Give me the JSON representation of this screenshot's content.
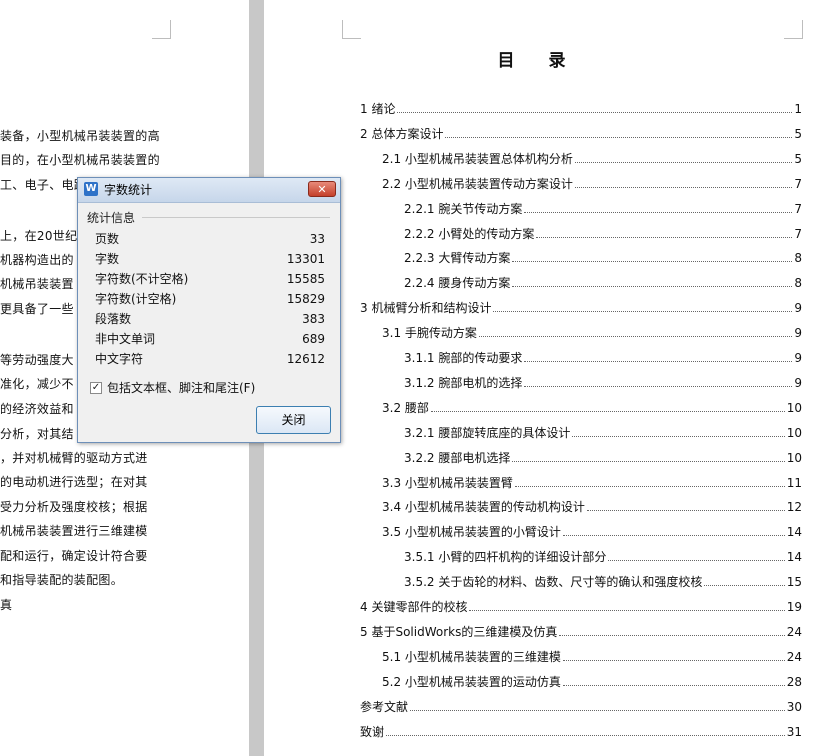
{
  "left_page": {
    "lines": [
      {
        "text": "装备，小型机械吊装装置的高"
      },
      {
        "text": "目的，在小型机械吊装装置的"
      },
      {
        "text": "工、电子、电路"
      },
      {
        "text": "上，在20世纪"
      },
      {
        "text": "机器构造出的"
      },
      {
        "text": "机械吊装装置"
      },
      {
        "text": "更具备了一些"
      },
      {
        "text": "等劳动强度大"
      },
      {
        "text": "准化，减少不"
      },
      {
        "text": "的经济效益和"
      },
      {
        "text": "分析，对其结"
      },
      {
        "text": "，并对机械臂的驱动方式进"
      },
      {
        "text": "的电动机进行选型；在对其"
      },
      {
        "text": "受力分析及强度校核；根据"
      },
      {
        "text": "机械吊装装置进行三维建模"
      },
      {
        "text": "配和运行，确定设计符合要"
      },
      {
        "text": "和指导装配的装配图。"
      },
      {
        "text": "真"
      }
    ]
  },
  "toc": {
    "title": "目 录",
    "entries": [
      {
        "label": "1 绪论",
        "page": "1",
        "indent": 0
      },
      {
        "label": "2 总体方案设计",
        "page": "5",
        "indent": 0
      },
      {
        "label": "2.1 小型机械吊装装置总体机构分析",
        "page": "5",
        "indent": 1
      },
      {
        "label": "2.2 小型机械吊装装置传动方案设计",
        "page": "7",
        "indent": 1
      },
      {
        "label": "2.2.1 腕关节传动方案",
        "page": "7",
        "indent": 2
      },
      {
        "label": "2.2.2 小臂处的传动方案",
        "page": "7",
        "indent": 2
      },
      {
        "label": "2.2.3 大臂传动方案",
        "page": "8",
        "indent": 2
      },
      {
        "label": "2.2.4 腰身传动方案",
        "page": "8",
        "indent": 2
      },
      {
        "label": "3 机械臂分析和结构设计",
        "page": "9",
        "indent": 0
      },
      {
        "label": "3.1 手腕传动方案",
        "page": "9",
        "indent": 1
      },
      {
        "label": "3.1.1 腕部的传动要求",
        "page": "9",
        "indent": 2
      },
      {
        "label": "3.1.2 腕部电机的选择",
        "page": "9",
        "indent": 2
      },
      {
        "label": "3.2 腰部",
        "page": "10",
        "indent": 1
      },
      {
        "label": "3.2.1 腰部旋转底座的具体设计",
        "page": "10",
        "indent": 2
      },
      {
        "label": "3.2.2 腰部电机选择",
        "page": "10",
        "indent": 2
      },
      {
        "label": "3.3 小型机械吊装装置臂",
        "page": "11",
        "indent": 1
      },
      {
        "label": "3.4 小型机械吊装装置的传动机构设计",
        "page": "12",
        "indent": 1
      },
      {
        "label": "3.5 小型机械吊装装置的小臂设计",
        "page": "14",
        "indent": 1
      },
      {
        "label": "3.5.1 小臂的四杆机构的详细设计部分",
        "page": "14",
        "indent": 2
      },
      {
        "label": "3.5.2 关于齿轮的材料、齿数、尺寸等的确认和强度校核",
        "page": "15",
        "indent": 2
      },
      {
        "label": "4 关键零部件的校核",
        "page": "19",
        "indent": 0
      },
      {
        "label": "5 基于SolidWorks的三维建模及仿真",
        "page": "24",
        "indent": 0
      },
      {
        "label": "5.1  小型机械吊装装置的三维建模",
        "page": "24",
        "indent": 1
      },
      {
        "label": "5.2 小型机械吊装装置的运动仿真",
        "page": "28",
        "indent": 1
      },
      {
        "label": "参考文献",
        "page": "30",
        "indent": 0
      },
      {
        "label": "致谢",
        "page": "31",
        "indent": 0
      }
    ]
  },
  "dialog": {
    "icon": "wps-writer-icon",
    "title": "字数统计",
    "close_glyph": "✕",
    "section_label": "统计信息",
    "stats": [
      {
        "label": "页数",
        "value": "33"
      },
      {
        "label": "字数",
        "value": "13301"
      },
      {
        "label": "字符数(不计空格)",
        "value": "15585"
      },
      {
        "label": "字符数(计空格)",
        "value": "15829"
      },
      {
        "label": "段落数",
        "value": "383"
      },
      {
        "label": "非中文单词",
        "value": "689"
      },
      {
        "label": "中文字符",
        "value": "12612"
      }
    ],
    "checkbox": {
      "label": "包括文本框、脚注和尾注(F)",
      "checked": true,
      "glyph": "✓"
    },
    "close_button": "关闭"
  }
}
